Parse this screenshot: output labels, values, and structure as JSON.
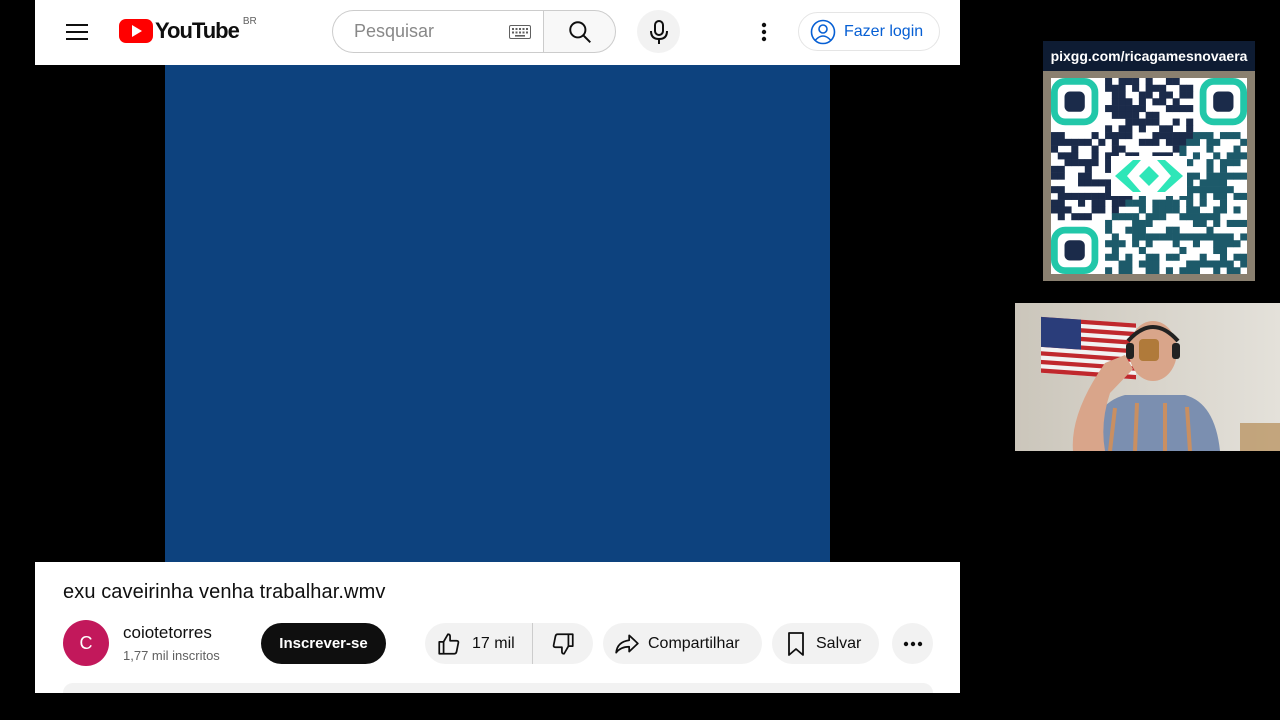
{
  "header": {
    "logo_text": "YouTube",
    "region": "BR",
    "search_placeholder": "Pesquisar",
    "login_label": "Fazer login"
  },
  "video": {
    "title": "exu caveirinha venha trabalhar.wmv",
    "color": "#0d427e"
  },
  "channel": {
    "avatar_letter": "C",
    "name": "coiotetorres",
    "subscribers": "1,77 mil inscritos",
    "subscribe_label": "Inscrever-se"
  },
  "actions": {
    "like_count": "17 mil",
    "share_label": "Compartilhar",
    "save_label": "Salvar"
  },
  "overlay": {
    "pix_url": "pixgg.com/ricagamesnovaera"
  },
  "colors": {
    "brand_red": "#ff0000",
    "link_blue": "#065fd4",
    "avatar": "#c2185b"
  }
}
